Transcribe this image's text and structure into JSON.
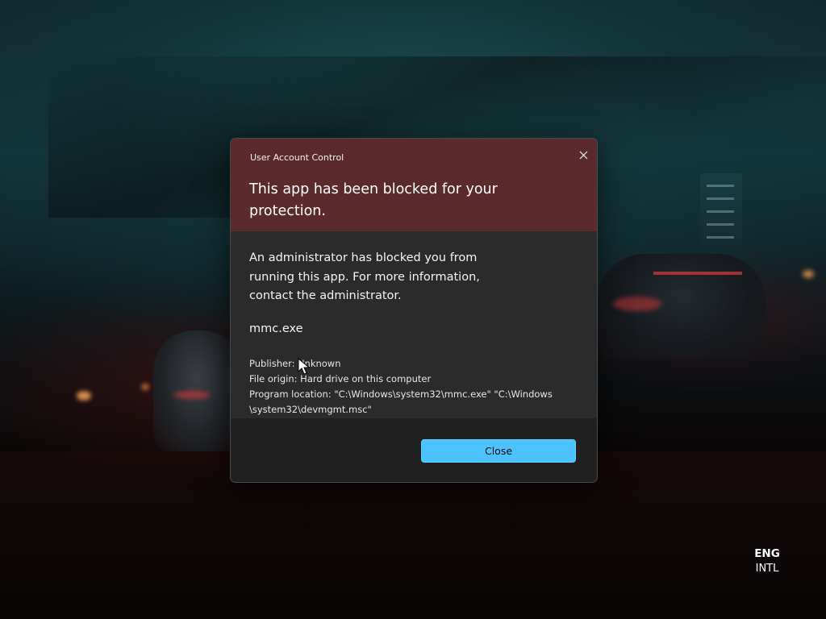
{
  "dialog": {
    "app_title": "User Account Control",
    "close_icon": "close-icon",
    "heading": "This app has been blocked for your protection.",
    "message": "An administrator has blocked you from running this app. For more information, contact the administrator.",
    "program_name": "mmc.exe",
    "details": {
      "publisher": "Publisher: Unknown",
      "file_origin": "File origin: Hard drive on this computer",
      "program_location_line1": "Program location: \"C:\\Windows\\system32\\mmc.exe\" \"C:\\Windows",
      "program_location_line2": "\\system32\\devmgmt.msc\""
    },
    "close_button_label": "Close",
    "colors": {
      "header_background": "#5a2a2c",
      "body_background": "#2b2b2b",
      "footer_background": "#202020",
      "accent_button": "#4cc2ff"
    }
  },
  "taskbar": {
    "language_code": "ENG",
    "keyboard_layout": "INTL"
  },
  "cursor": {
    "icon": "arrow-cursor-icon"
  }
}
